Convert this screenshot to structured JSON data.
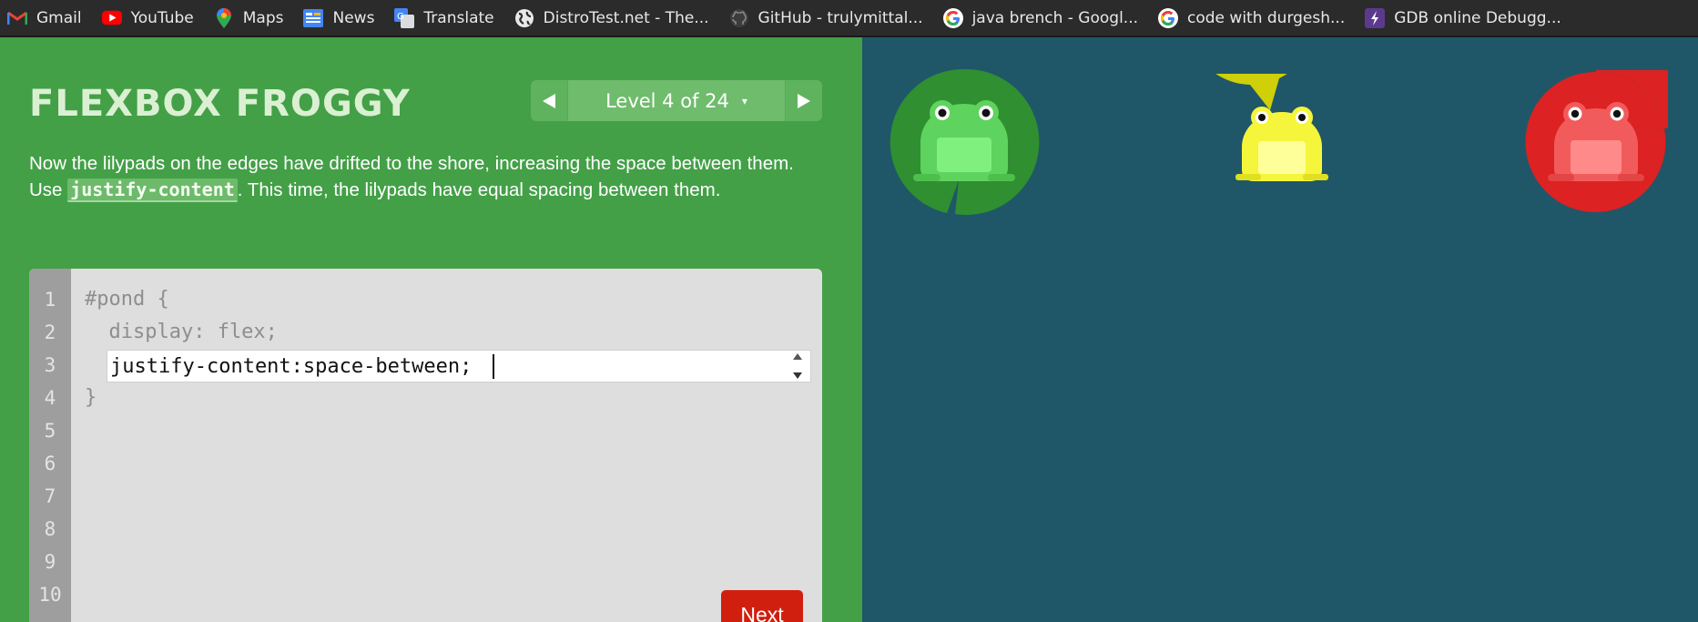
{
  "bookmarks": [
    {
      "label": "Gmail",
      "icon": "gmail-icon"
    },
    {
      "label": "YouTube",
      "icon": "youtube-icon"
    },
    {
      "label": "Maps",
      "icon": "maps-icon"
    },
    {
      "label": "News",
      "icon": "news-icon"
    },
    {
      "label": "Translate",
      "icon": "translate-icon"
    },
    {
      "label": "DistroTest.net - The...",
      "icon": "globe-icon"
    },
    {
      "label": "GitHub - trulymittal...",
      "icon": "github-icon"
    },
    {
      "label": "java brench - Googl...",
      "icon": "google-icon"
    },
    {
      "label": "code with durgesh...",
      "icon": "google-icon"
    },
    {
      "label": "GDB online Debugg...",
      "icon": "gdb-icon"
    }
  ],
  "game": {
    "title": "FLEXBOX FROGGY",
    "level_label": "Level 4 of 24",
    "level_caret": "▾",
    "instructions": {
      "before": "Now the lilypads on the edges have drifted to the shore, increasing the space between them. Use ",
      "code": "justify-content",
      "after": ". This time, the lilypads have equal spacing between them."
    }
  },
  "editor": {
    "line_numbers": [
      "1",
      "2",
      "3",
      "4",
      "5",
      "6",
      "7",
      "8",
      "9",
      "10"
    ],
    "line1": "#pond {",
    "line2": "  display: flex;",
    "line4": "}",
    "input_value": "justify-content:space-between;",
    "next_label": "Next"
  },
  "pond": {
    "frogs": [
      {
        "name": "green",
        "lily_color": "#2e8b2e",
        "frog_color": "#5fd35f"
      },
      {
        "name": "yellow",
        "lily_color": "#c8c80a",
        "frog_color": "#f4f43a"
      },
      {
        "name": "red",
        "lily_color": "#d42020",
        "frog_color": "#f05a5a"
      }
    ]
  },
  "colors": {
    "panel_green": "#43a047",
    "pond_blue": "#1f5768",
    "next_red": "#d01f0e"
  }
}
